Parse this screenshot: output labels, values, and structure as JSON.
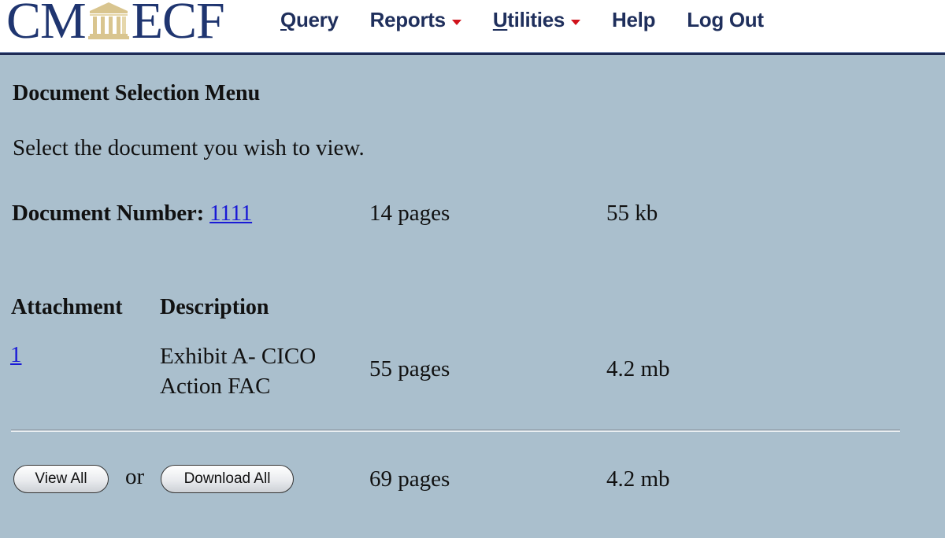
{
  "header": {
    "logo": {
      "left_text": "CM",
      "right_text": "ECF",
      "icon": "courthouse-icon"
    },
    "logo_colors": {
      "text": "#1f3570",
      "icon": "#d9c58f"
    },
    "nav": [
      {
        "label": "Query",
        "underline_char": "Q",
        "rest": "uery",
        "dropdown": false
      },
      {
        "label": "Reports",
        "dropdown": true
      },
      {
        "label": "Utilities",
        "underline_char": "U",
        "rest": "tilities",
        "dropdown": true
      },
      {
        "label": "Help",
        "dropdown": false
      },
      {
        "label": "Log Out",
        "dropdown": false
      }
    ],
    "dropdown_caret_color": "#d0121b"
  },
  "main": {
    "title": "Document Selection Menu",
    "instructions": "Select the document you wish to view.",
    "document": {
      "label": "Document Number:",
      "number": "1111",
      "pages": "14 pages",
      "size": "55 kb"
    },
    "table": {
      "headers": [
        "Attachment",
        "Description"
      ],
      "rows": [
        {
          "attachment": "1",
          "description_line1": "Exhibit A- CICO",
          "description_line2": "Action FAC",
          "pages": "55 pages",
          "size": "4.2 mb"
        }
      ]
    },
    "actions": {
      "view_all_label": "View All",
      "or_text": "or",
      "download_all_label": "Download All",
      "total_pages": "69 pages",
      "total_size": "4.2 mb"
    }
  },
  "colors": {
    "background": "#aabfcd",
    "header_rule": "#1e2a54",
    "link": "#1a1ad6"
  }
}
